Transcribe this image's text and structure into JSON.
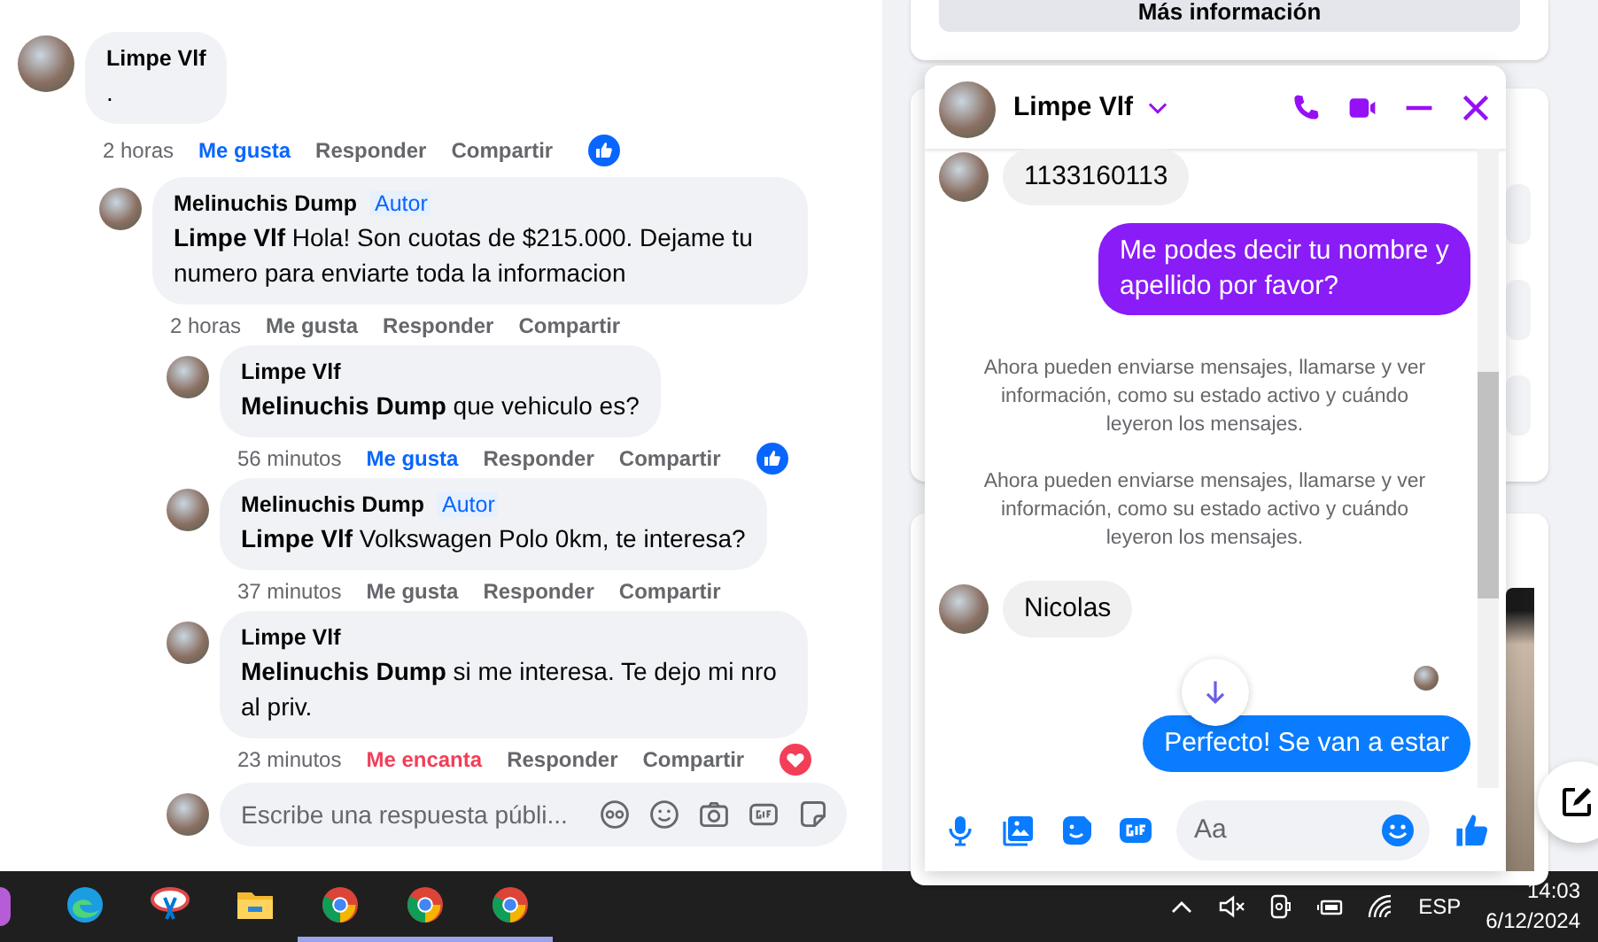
{
  "comments": [
    {
      "name": "Limpe Vlf",
      "text": ".",
      "time": "2 horas",
      "reaction": {
        "label": "Me gusta",
        "selected": true,
        "color": "#0866ff"
      },
      "reply": "Responder",
      "share": "Compartir",
      "reactions": [
        {
          "kind": "like"
        }
      ],
      "children": [
        {
          "name": "Melinuchis Dump",
          "badge": "Autor",
          "text": "**Limpe Vlf** Hola! Son cuotas de $215.000. Dejame tu numero para enviarte toda la informacion",
          "time": "2 horas",
          "reaction": {
            "label": "Me gusta",
            "selected": false
          },
          "reply": "Responder",
          "share": "Compartir",
          "children": [
            {
              "name": "Limpe Vlf",
              "text": "**Melinuchis Dump** que vehiculo es?",
              "time": "56 minutos",
              "reaction": {
                "label": "Me gusta",
                "selected": true,
                "color": "#0866ff"
              },
              "reply": "Responder",
              "share": "Compartir",
              "reactions": [
                {
                  "kind": "like"
                }
              ]
            },
            {
              "name": "Melinuchis Dump",
              "badge": "Autor",
              "text": "**Limpe Vlf** Volkswagen Polo 0km, te interesa?",
              "time": "37 minutos",
              "reaction": {
                "label": "Me gusta",
                "selected": false
              },
              "reply": "Responder",
              "share": "Compartir"
            },
            {
              "name": "Limpe Vlf",
              "text": "**Melinuchis Dump** si me interesa. Te dejo mi nro al priv.",
              "time": "23 minutos",
              "reaction": {
                "label": "Me encanta",
                "selected": true,
                "color": "#f33e58"
              },
              "reply": "Responder",
              "share": "Compartir",
              "reactions": [
                {
                  "kind": "love"
                }
              ]
            }
          ]
        }
      ]
    }
  ],
  "reply_box": {
    "placeholder": "Escribe una respuesta públi..."
  },
  "side_card": {
    "button": "Más información"
  },
  "chat": {
    "title": "Limpe Vlf",
    "messages": [
      {
        "kind": "incoming",
        "text": "1133160113"
      },
      {
        "kind": "outgoing",
        "text": "Me podes decir tu nombre y apellido por favor?",
        "color": "#8a1cf7"
      },
      {
        "kind": "system",
        "text": "Ahora pueden enviarse mensajes, llamarse y ver información, como su estado activo y cuándo leyeron los mensajes."
      },
      {
        "kind": "system",
        "text": "Ahora pueden enviarse mensajes, llamarse y ver información, como su estado activo y cuándo leyeron los mensajes."
      },
      {
        "kind": "incoming",
        "text": "Nicolas"
      },
      {
        "kind": "seen"
      },
      {
        "kind": "outgoing",
        "text": "Perfecto!  Se van a estar",
        "color": "#0a7cff"
      }
    ],
    "input": {
      "placeholder": "Aa"
    }
  },
  "taskbar": {
    "apps": [
      {
        "kind": "edge",
        "running": false
      },
      {
        "kind": "snip",
        "running": false
      },
      {
        "kind": "folder",
        "running": false
      },
      {
        "kind": "chrome",
        "running": true
      },
      {
        "kind": "chrome",
        "running": true
      },
      {
        "kind": "chrome",
        "running": true
      }
    ],
    "language": "ESP",
    "time": "14:03",
    "date": "6/12/2024"
  }
}
